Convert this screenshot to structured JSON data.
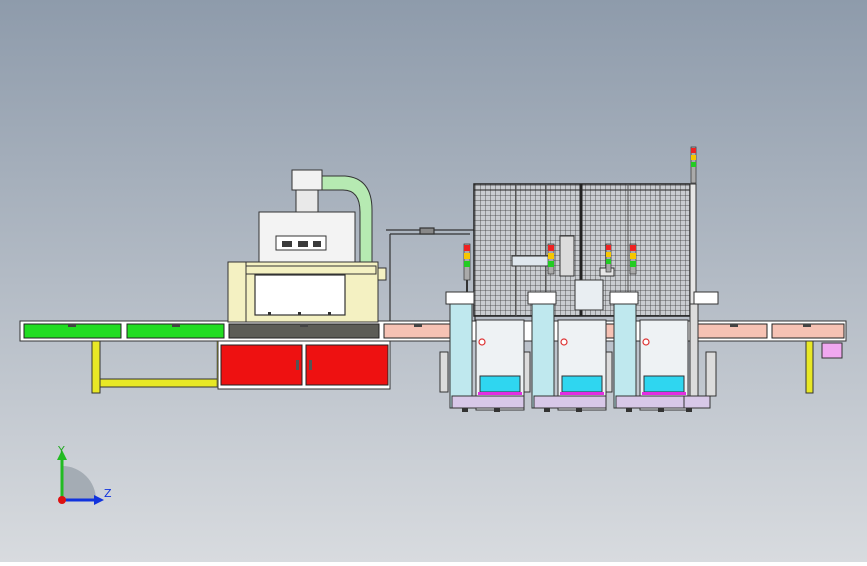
{
  "scene": {
    "colors": {
      "bg_top": "#8e9bab",
      "bg_bottom": "#d8dbdf",
      "conveyor_green": "#22dd22",
      "conveyor_pink": "#f6c2b4",
      "cabinet_red": "#ee1111",
      "hood_cream": "#f4f1c2",
      "leg_yellow": "#e8e826",
      "duct_green": "#b6eab2",
      "screen_blue": "#2fd6f0",
      "frame_cyan": "#bfe8ee",
      "magenta": "#e22ee2",
      "dark_panel": "#5c5c56"
    },
    "triad": {
      "y_label": "Y",
      "z_label": "Z",
      "y_color": "#22bb22",
      "z_color": "#1133dd",
      "origin_color": "#dd1111"
    }
  }
}
